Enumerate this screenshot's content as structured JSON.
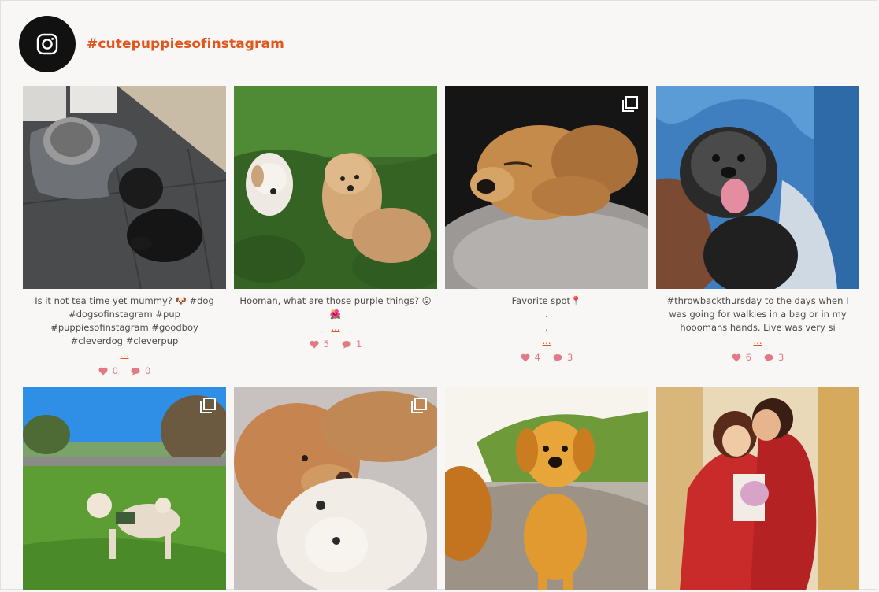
{
  "header": {
    "hashtag": "#cutepuppiesofinstagram",
    "icon": "instagram-icon"
  },
  "colors": {
    "accent": "#e2551b",
    "stats": "#e07b85",
    "avatar_bg": "#111111"
  },
  "posts": [
    {
      "caption": "Is it not tea time yet mummy? 🐶 #dog #dogsofinstagram #pup #puppiesofinstagram #goodboy #cleverdog #cleverpup",
      "more": "...",
      "likes": "0",
      "comments": "0",
      "multi": false
    },
    {
      "caption": "Hooman, what are those purple things? 😮\n🌺",
      "more": "...",
      "likes": "5",
      "comments": "1",
      "multi": false
    },
    {
      "caption": "Favorite spot📍\n.\n.",
      "more": "...",
      "likes": "4",
      "comments": "3",
      "multi": true
    },
    {
      "caption": "#throwbackthursday to the days when I was going for walkies in a bag or in my hooomans hands. Live was very si",
      "more": "...",
      "likes": "6",
      "comments": "3",
      "multi": false
    },
    {
      "multi": true
    },
    {
      "multi": true
    },
    {
      "multi": false
    },
    {
      "multi": false
    }
  ]
}
